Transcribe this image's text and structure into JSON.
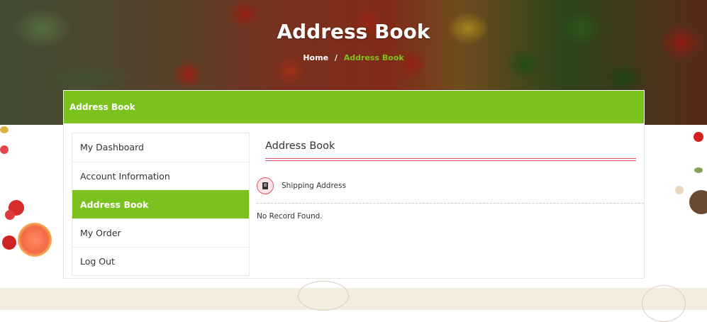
{
  "hero": {
    "title": "Address Book",
    "breadcrumb": {
      "home": "Home",
      "separator": "/",
      "current": "Address Book"
    }
  },
  "panel": {
    "header_title": "Address Book"
  },
  "sidebar": {
    "items": [
      {
        "label": "My Dashboard",
        "active": false
      },
      {
        "label": "Account Information",
        "active": false
      },
      {
        "label": "Address Book",
        "active": true
      },
      {
        "label": "My Order",
        "active": false
      },
      {
        "label": "Log Out",
        "active": false
      }
    ]
  },
  "main": {
    "title": "Address Book",
    "shipping_label": "Shipping Address",
    "shipping_icon": "address-book-icon",
    "empty_message": "No Record Found."
  },
  "colors": {
    "accent_green": "#7cc21f",
    "accent_red": "#e0566a",
    "footer_bg": "#f3ede0"
  }
}
